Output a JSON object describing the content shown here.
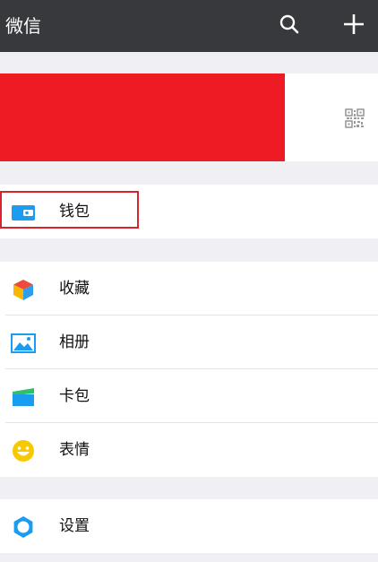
{
  "header": {
    "title": "微信",
    "search_icon": "search-icon",
    "add_icon": "plus-icon"
  },
  "profile": {
    "qr_icon": "qr-code-icon"
  },
  "menu": {
    "wallet": {
      "label": "钱包",
      "icon": "wallet-icon"
    },
    "favorites": {
      "label": "收藏",
      "icon": "cube-icon"
    },
    "album": {
      "label": "相册",
      "icon": "photo-icon"
    },
    "cards": {
      "label": "卡包",
      "icon": "card-wallet-icon"
    },
    "stickers": {
      "label": "表情",
      "icon": "smiley-icon"
    },
    "settings": {
      "label": "设置",
      "icon": "gear-icon"
    }
  },
  "colors": {
    "topbar": "#38393d",
    "background": "#efeff4",
    "redaction": "#ee1b24",
    "highlight": "#d9232d",
    "wallet_blue": "#1a9cf0",
    "sticker_yellow": "#f8c800"
  }
}
